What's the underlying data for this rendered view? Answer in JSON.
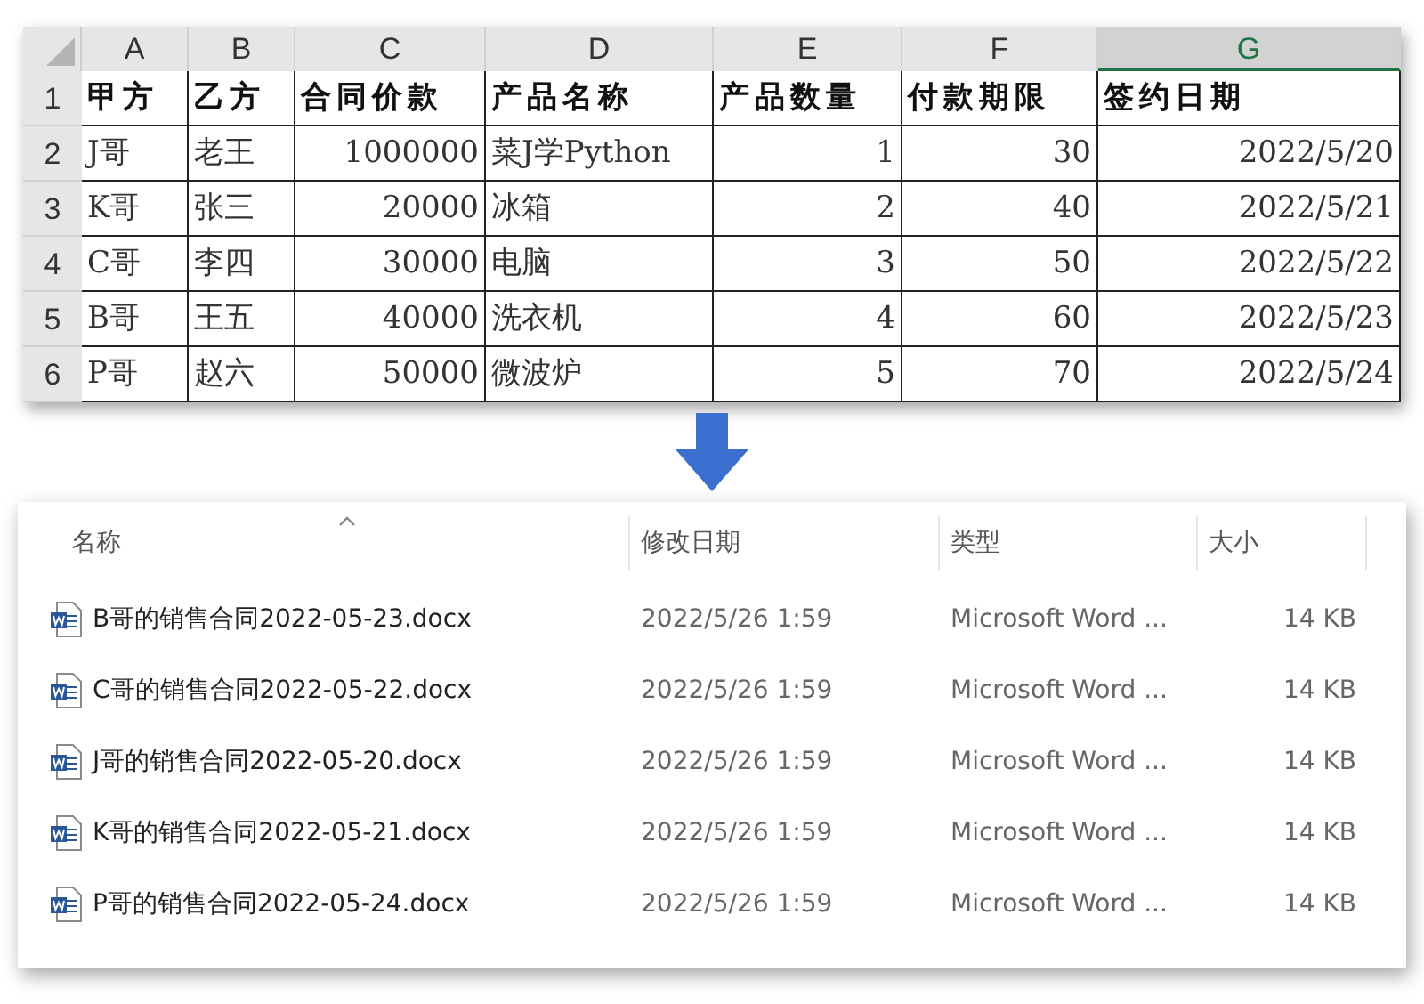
{
  "spreadsheet": {
    "columns": [
      {
        "label": "A",
        "selected": false,
        "kind": "text"
      },
      {
        "label": "B",
        "selected": false,
        "kind": "text"
      },
      {
        "label": "C",
        "selected": false,
        "kind": "number"
      },
      {
        "label": "D",
        "selected": false,
        "kind": "text"
      },
      {
        "label": "E",
        "selected": false,
        "kind": "number"
      },
      {
        "label": "F",
        "selected": false,
        "kind": "number"
      },
      {
        "label": "G",
        "selected": true,
        "kind": "number"
      }
    ],
    "rows": [
      {
        "number": "1",
        "kind": "header",
        "cells": [
          "甲方",
          "乙方",
          "合同价款",
          "产品名称",
          "产品数量",
          "付款期限",
          "签约日期"
        ]
      },
      {
        "number": "2",
        "kind": "record",
        "cells": [
          "J哥",
          "老王",
          "1000000",
          "菜J学Python",
          "1",
          "30",
          "2022/5/20"
        ]
      },
      {
        "number": "3",
        "kind": "record",
        "cells": [
          "K哥",
          "张三",
          "20000",
          "冰箱",
          "2",
          "40",
          "2022/5/21"
        ]
      },
      {
        "number": "4",
        "kind": "record",
        "cells": [
          "C哥",
          "李四",
          "30000",
          "电脑",
          "3",
          "50",
          "2022/5/22"
        ]
      },
      {
        "number": "5",
        "kind": "record",
        "cells": [
          "B哥",
          "王五",
          "40000",
          "洗衣机",
          "4",
          "60",
          "2022/5/23"
        ]
      },
      {
        "number": "6",
        "kind": "record",
        "cells": [
          "P哥",
          "赵六",
          "50000",
          "微波炉",
          "5",
          "70",
          "2022/5/24"
        ]
      }
    ]
  },
  "explorer": {
    "columns": [
      "名称",
      "修改日期",
      "类型",
      "大小"
    ],
    "files": [
      {
        "name": "B哥的销售合同2022-05-23.docx",
        "modified": "2022/5/26 1:59",
        "type": "Microsoft Word ...",
        "size": "14 KB"
      },
      {
        "name": "C哥的销售合同2022-05-22.docx",
        "modified": "2022/5/26 1:59",
        "type": "Microsoft Word ...",
        "size": "14 KB"
      },
      {
        "name": "J哥的销售合同2022-05-20.docx",
        "modified": "2022/5/26 1:59",
        "type": "Microsoft Word ...",
        "size": "14 KB"
      },
      {
        "name": "K哥的销售合同2022-05-21.docx",
        "modified": "2022/5/26 1:59",
        "type": "Microsoft Word ...",
        "size": "14 KB"
      },
      {
        "name": "P哥的销售合同2022-05-24.docx",
        "modified": "2022/5/26 1:59",
        "type": "Microsoft Word ...",
        "size": "14 KB"
      }
    ]
  }
}
